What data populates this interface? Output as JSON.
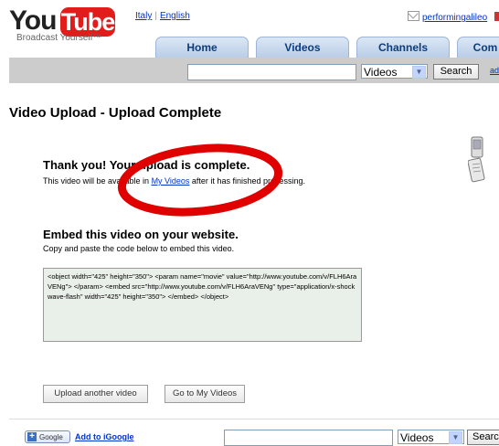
{
  "header": {
    "logo_you": "You",
    "logo_tube": "Tube",
    "tagline": "Broadcast Yourself™",
    "languages": [
      "Italy",
      "English"
    ],
    "username": "performingalileo",
    "partial": "("
  },
  "tabs": [
    "Home",
    "Videos",
    "Channels",
    "Com"
  ],
  "search": {
    "value": "",
    "category": "Videos",
    "button": "Search",
    "advanced_link": "ad"
  },
  "page": {
    "title": "Video Upload - Upload Complete",
    "thanks_title": "Thank you! Your upload is complete.",
    "thanks_prefix": "This video will be available in ",
    "my_videos_link": "My Videos",
    "thanks_suffix": " after it has finished processing.",
    "embed_title": "Embed this video on your website.",
    "embed_desc": "Copy and paste the code below to embed this video.",
    "embed_code": "<object width=\"425\" height=\"350\"> <param name=\"movie\" value=\"http://www.youtube.com/v/FLH6AraVENg\"> </param> <embed src=\"http://www.youtube.com/v/FLH6AraVENg\" type=\"application/x-shockwave-flash\" width=\"425\" height=\"350\"> </embed> </object>"
  },
  "buttons": {
    "upload_another": "Upload another video",
    "go_to_my_videos": "Go to My Videos"
  },
  "footer": {
    "google_badge": "Google",
    "add_igoogle": "Add to iGoogle",
    "category": "Videos",
    "search_button": "Search"
  },
  "colors": {
    "annotation_red": "#e00000",
    "logo_red": "#e21b1b",
    "link": "#0033cc"
  }
}
